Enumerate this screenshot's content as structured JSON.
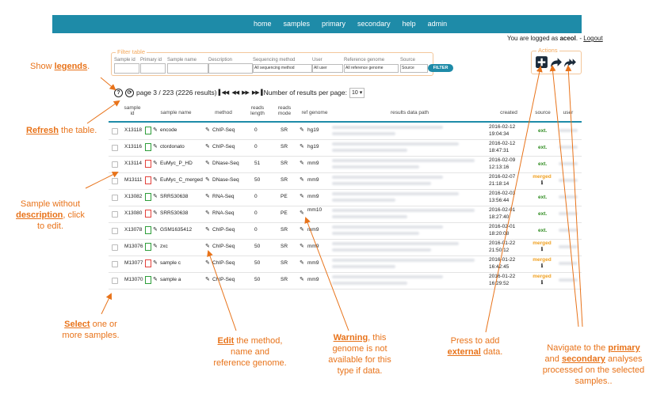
{
  "nav": {
    "items": [
      "home",
      "samples",
      "primary",
      "secondary",
      "help",
      "admin"
    ]
  },
  "login": {
    "prefix": "You are logged as ",
    "user": "aceol",
    "sep": ". - ",
    "logout": "Logout"
  },
  "filter": {
    "legend": "Filter table",
    "labels": [
      "Sample id",
      "Primary id",
      "Sample name",
      "Description",
      "Sequencing method",
      "User",
      "Reference genome",
      "Source"
    ],
    "selects": {
      "method": "All sequencing method",
      "user": "All user",
      "genome": "All reference genome",
      "source": "Source"
    },
    "button": "FILTER"
  },
  "actions": {
    "legend": "Actions"
  },
  "pager": {
    "help_icon": "?",
    "text": "page 3 / 223 (2226 results)",
    "per_page_label": "Number of results per page:",
    "per_page": "10"
  },
  "table": {
    "headers": [
      "sample id",
      "sample name",
      "method",
      "reads length",
      "reads mode",
      "ref genome",
      "results data path",
      "created",
      "source",
      "user"
    ],
    "rows": [
      {
        "id": "X13118",
        "name": "encode",
        "method": "ChIP-Seq",
        "len": "0",
        "mode": "SR",
        "genome": "hg19",
        "date": "2016-02-12",
        "time": "19:04:34",
        "source": "ext.",
        "doc": "ok"
      },
      {
        "id": "X13116",
        "name": "ctordonato",
        "method": "ChIP-Seq",
        "len": "0",
        "mode": "SR",
        "genome": "hg19",
        "date": "2016-02-12",
        "time": "18:47:31",
        "source": "ext.",
        "doc": "ok"
      },
      {
        "id": "X13114",
        "name": "EuMyc_P_HD",
        "method": "DNase-Seq",
        "len": "51",
        "mode": "SR",
        "genome": "mm9",
        "date": "2016-02-09",
        "time": "12:13:16",
        "source": "ext.",
        "doc": "no"
      },
      {
        "id": "M13111",
        "name": "EuMyc_C_merged",
        "method": "DNase-Seq",
        "len": "50",
        "mode": "SR",
        "genome": "mm9",
        "date": "2016-02-07",
        "time": "21:18:14",
        "source": "merged",
        "doc": "no"
      },
      {
        "id": "X13082",
        "name": "SRR530638",
        "method": "RNA-Seq",
        "len": "0",
        "mode": "PE",
        "genome": "mm9",
        "date": "2016-02-03",
        "time": "13:56:44",
        "source": "ext.",
        "doc": "ok"
      },
      {
        "id": "X13080",
        "name": "SRR530638",
        "method": "RNA-Seq",
        "len": "0",
        "mode": "PE",
        "genome": "mm10",
        "date": "2016-02-01",
        "time": "18:27:40",
        "source": "ext.",
        "doc": "no"
      },
      {
        "id": "X13078",
        "name": "GSM1635412",
        "method": "ChIP-Seq",
        "len": "0",
        "mode": "SR",
        "genome": "mm9",
        "date": "2016-02-01",
        "time": "18:20:08",
        "source": "ext.",
        "doc": "ok"
      },
      {
        "id": "M13076",
        "name": "zxc",
        "method": "ChIP-Seq",
        "len": "50",
        "mode": "SR",
        "genome": "mm9",
        "date": "2016-01-22",
        "time": "21:50:12",
        "source": "merged",
        "doc": "ok"
      },
      {
        "id": "M13077",
        "name": "sample c",
        "method": "ChIP-Seq",
        "len": "50",
        "mode": "SR",
        "genome": "mm9",
        "date": "2016-01-22",
        "time": "16:42:45",
        "source": "merged",
        "doc": "no"
      },
      {
        "id": "M13070",
        "name": "sample a",
        "method": "ChIP-Seq",
        "len": "50",
        "mode": "SR",
        "genome": "mm9",
        "date": "2016-01-22",
        "time": "16:29:52",
        "source": "merged",
        "doc": "ok"
      }
    ]
  },
  "annotations": {
    "legends": {
      "pre": "Show ",
      "key": "legends",
      "post": "."
    },
    "refresh": {
      "key": "Refresh",
      "post": " the table."
    },
    "nodesc": {
      "l1": "Sample without",
      "key": "description",
      "post": ", click",
      "l3": "to edit."
    },
    "select": {
      "key": "Select",
      "post": " one or",
      "l2": "more samples."
    },
    "edit": {
      "key": "Edit",
      "post": " the method,",
      "l2": "name and",
      "l3": "reference genome."
    },
    "warning": {
      "key": "Warning",
      "post": ", this",
      "l2": "genome is not",
      "l3": "available for this",
      "l4": "type if data."
    },
    "external": {
      "l1": "Press to add",
      "key": "external",
      "post": " data."
    },
    "navigate": {
      "pre": "Navigate to the ",
      "key1": "primary",
      "l2pre": "and ",
      "key2": "secondary",
      "l2post": " analyses",
      "l3": "processed on the selected",
      "l4": "samples.."
    }
  },
  "colors": {
    "accent": "#1e8ba8",
    "annotation": "#e8731a",
    "ext": "#2e8b1f",
    "merged": "#f0a020"
  }
}
